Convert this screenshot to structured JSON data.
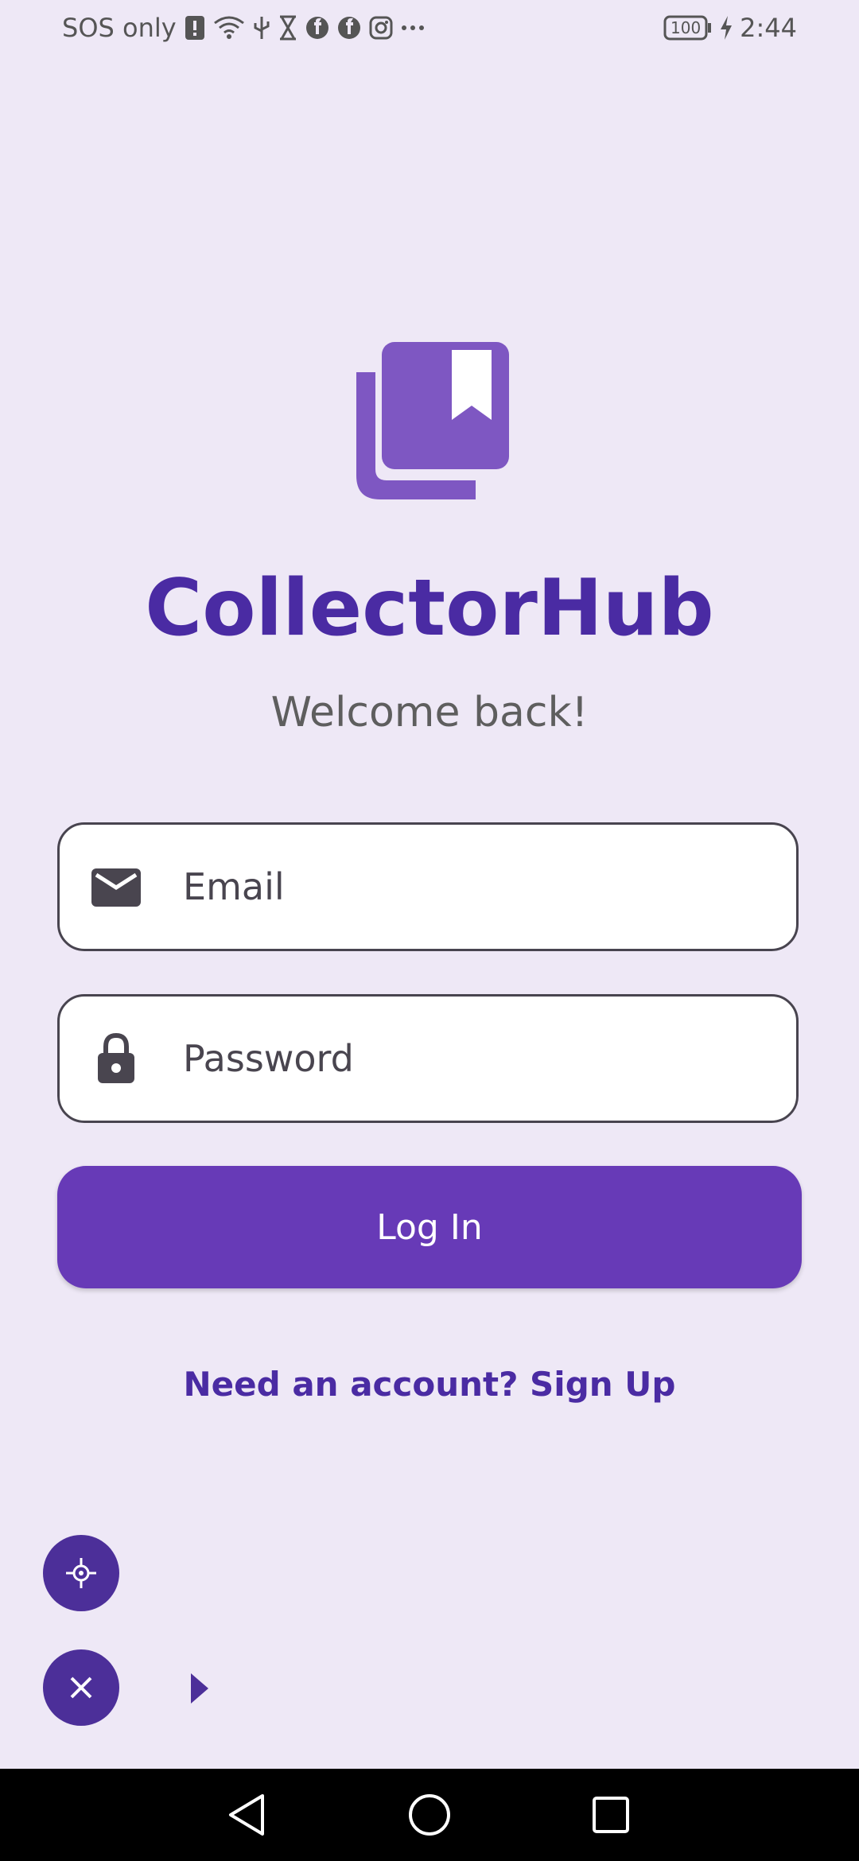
{
  "status_bar": {
    "carrier": "SOS only",
    "battery": "100",
    "time": "2:44",
    "icons": [
      "alert-icon",
      "wifi-icon",
      "usb-icon",
      "hourglass-icon",
      "facebook-icon",
      "facebook-icon",
      "instagram-icon",
      "more-icon"
    ]
  },
  "app": {
    "title": "CollectorHub",
    "subtitle": "Welcome back!",
    "logo_icon": "collections-bookmark-icon"
  },
  "form": {
    "email": {
      "placeholder": "Email",
      "value": "",
      "icon": "mail-icon"
    },
    "password": {
      "placeholder": "Password",
      "value": "",
      "icon": "lock-icon"
    },
    "login_label": "Log In",
    "signup_label": "Need an account? Sign Up"
  },
  "floating": {
    "locate_icon": "crosshair-icon",
    "close_icon": "close-icon",
    "handle_icon": "arrow-right-icon"
  },
  "navigation": {
    "back_icon": "back-icon",
    "home_icon": "home-icon",
    "recents_icon": "recents-icon"
  },
  "colors": {
    "background": "#EEE8F6",
    "primary": "#673AB7",
    "title": "#4A2BA3",
    "logo": "#7E57C2",
    "fab": "#4C2F99"
  }
}
